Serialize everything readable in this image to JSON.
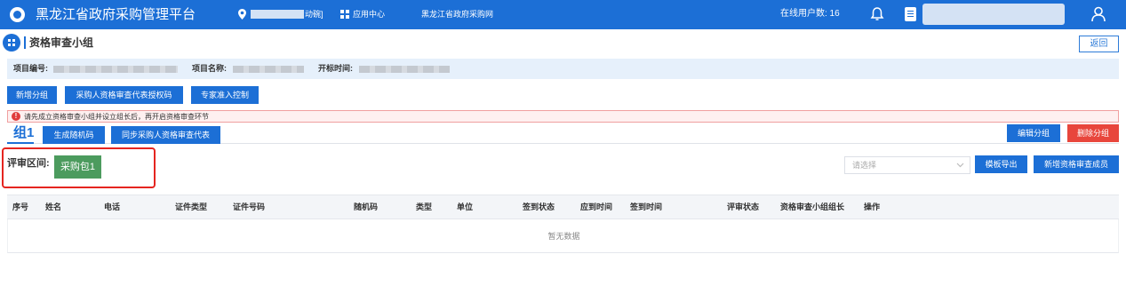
{
  "topbar": {
    "title": "黑龙江省政府采购管理平台",
    "location_suffix": "动碗]",
    "apps_label": "应用中心",
    "portal_link": "黑龙江省政府采购网",
    "online_users": "在线用户数: 16"
  },
  "page": {
    "title": "资格审查小组",
    "back_label": "返回"
  },
  "info": {
    "project_no_label": "项目编号:",
    "project_name_label": "项目名称:",
    "open_time_label": "开标时间:"
  },
  "actions": {
    "new_group": "新增分组",
    "authorize_code": "采购人资格审查代表授权码",
    "expert_control": "专家准入控制"
  },
  "warning": {
    "text": "请先成立资格审查小组并设立组长后，再开启资格审查环节"
  },
  "group": {
    "tab_label": "组1",
    "gen_random_code": "生成随机码",
    "sync_reps": "同步采购人资格审查代表",
    "edit_group": "编辑分组",
    "delete_group": "删除分组"
  },
  "review": {
    "zone_label": "评审区间:",
    "package_label": "采购包1",
    "select_placeholder": "请选择",
    "template_export": "模板导出",
    "add_member": "新增资格审查成员"
  },
  "table": {
    "columns": [
      "序号",
      "姓名",
      "电话",
      "证件类型",
      "证件号码",
      "随机码",
      "类型",
      "单位",
      "签到状态",
      "应到时间",
      "签到时间",
      "评审状态",
      "资格审查小组组长",
      "操作"
    ],
    "empty_text": "暂无数据"
  },
  "colors": {
    "primary": "#1c6fd6",
    "danger": "#e8463c",
    "success": "#4c9b5e",
    "highlight_box": "#e52520"
  },
  "icons": {
    "logo": "logo-icon",
    "location": "location-pin-icon",
    "apps": "grid-icon",
    "bell": "bell-icon",
    "document": "document-icon",
    "user": "user-icon",
    "page": "grid-icon",
    "warning": "exclamation-circle-icon",
    "select": "chevron-down-icon"
  }
}
